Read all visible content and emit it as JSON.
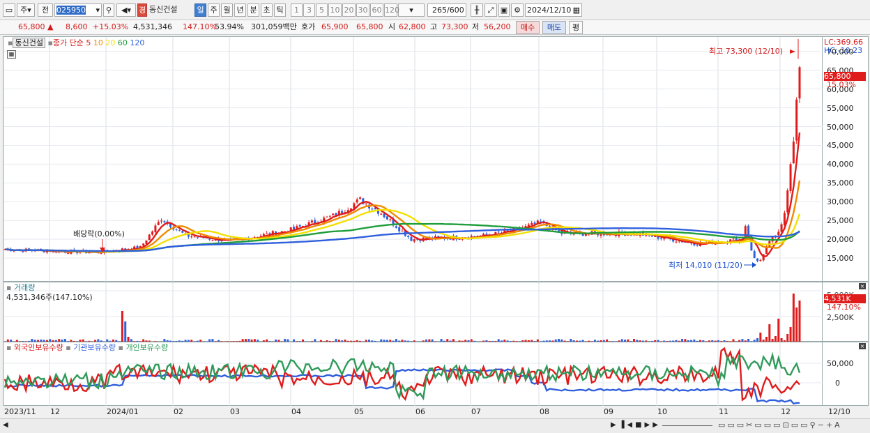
{
  "toolbar": {
    "period_btn": "주",
    "prev_btn": "전",
    "code": "025950",
    "badge": "경",
    "stock_name": "동신건설",
    "tf_tabs": [
      "일",
      "주",
      "월",
      "년",
      "분",
      "초",
      "틱"
    ],
    "active_tf": "일",
    "num_tabs": [
      "1",
      "3",
      "5",
      "10",
      "20",
      "30",
      "60",
      "120"
    ],
    "count": "265",
    "count_total": "/600",
    "date": "2024/12/10"
  },
  "quote": {
    "price": "65,800",
    "arrow": "▲",
    "change": "8,600",
    "rate": "+15.03%",
    "volume": "4,531,346",
    "vol_ratio": "147.10%",
    "turnover": "53.94%",
    "amount": "301,059백만",
    "ask_label": "호가",
    "ask1": "65,900",
    "ask2": "65,800",
    "open_label": "시",
    "open": "62,800",
    "high_label": "고",
    "high": "73,300",
    "low_label": "저",
    "low": "56,200",
    "buy_btn": "매수",
    "sell_btn": "매도",
    "eval_btn": "평"
  },
  "price_pane": {
    "name_tag": "동신건설",
    "ma_label": "종가 단순",
    "ma_periods": [
      "5",
      "10",
      "20",
      "60",
      "120"
    ],
    "ma_colors": [
      "#e01b1b",
      "#f08a00",
      "#f2e000",
      "#1f9d3a",
      "#2f5fdc"
    ],
    "lc": "LC:369.66",
    "hc": "HC:-10.23",
    "high_note": "최고 73,300 (12/10)",
    "low_note": "최저 14,010 (11/20)",
    "dividend_note": "배당락(0.00%)",
    "price_tag": "65,800",
    "pct_tag": "15.03%",
    "ticks": [
      "70,000",
      "65,000",
      "60,000",
      "55,000",
      "50,000",
      "45,000",
      "40,000",
      "35,000",
      "30,000",
      "25,000",
      "20,000",
      "15,000"
    ]
  },
  "volume_pane": {
    "title": "거래량",
    "value": "4,531,346주(147.10%)",
    "tag": "4,531K",
    "pct_tag": "147.10%",
    "ticks": [
      "5,000K",
      "2,500K"
    ]
  },
  "holding_pane": {
    "items": [
      "외국인보유수량",
      "기관보유수량",
      "개인보유수량"
    ],
    "colors": [
      "#e01b1b",
      "#2f5fdc",
      "#2f9a5a"
    ],
    "ticks": [
      "50,000",
      "0"
    ]
  },
  "xaxis": {
    "labels": [
      "2023/11",
      "12",
      "2024/01",
      "02",
      "03",
      "04",
      "05",
      "06",
      "07",
      "08",
      "09",
      "10",
      "11",
      "12"
    ],
    "right_label": "12/10"
  }
}
